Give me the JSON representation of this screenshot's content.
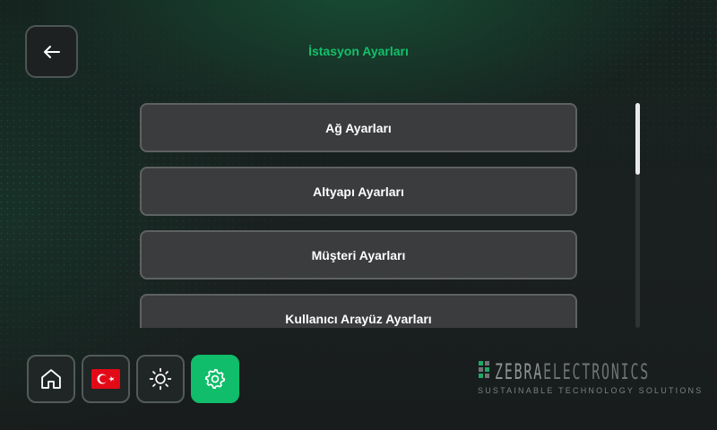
{
  "header": {
    "title": "İstasyon Ayarları",
    "back_icon": "arrow-left-icon"
  },
  "menu": {
    "items": [
      {
        "label": "Ağ Ayarları"
      },
      {
        "label": "Altyapı Ayarları"
      },
      {
        "label": "Müşteri Ayarları"
      },
      {
        "label": "Kullanıcı Arayüz Ayarları"
      }
    ]
  },
  "bottom_nav": {
    "items": [
      {
        "name": "home",
        "icon": "home-icon"
      },
      {
        "name": "language",
        "icon": "turkey-flag-icon"
      },
      {
        "name": "brightness",
        "icon": "sun-icon"
      },
      {
        "name": "settings",
        "icon": "gear-icon",
        "active": true
      }
    ]
  },
  "brand": {
    "name_part1": "ZEBRA",
    "name_part2": "ELECTRONICS",
    "tagline": "SUSTAINABLE TECHNOLOGY SOLUTIONS"
  },
  "colors": {
    "accent": "#0fbd6a",
    "button_bg": "#3b3c3e",
    "flag_red": "#e30a17"
  }
}
